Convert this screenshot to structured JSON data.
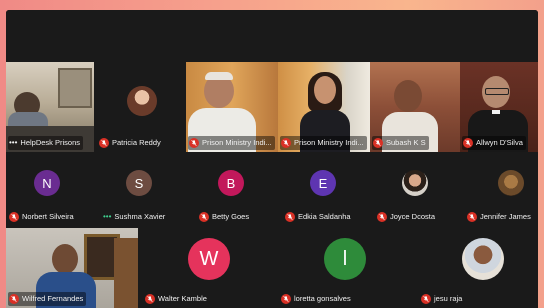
{
  "participants": {
    "helpdesk": {
      "name": "HelpDesk Prisons"
    },
    "patricia": {
      "name": "Patricia Reddy"
    },
    "prison1": {
      "name": "Prison Ministry Indi..."
    },
    "prison2": {
      "name": "Prison Ministry Indi..."
    },
    "subash": {
      "name": "Subash K S"
    },
    "allwyn": {
      "name": "Allwyn D'Silva"
    },
    "norbert": {
      "name": "Norbert Silveira",
      "initial": "N",
      "color": "#6a2c91"
    },
    "sushma": {
      "name": "Sushma Xavier",
      "initial": "S",
      "color": "#6d4c41"
    },
    "betty": {
      "name": "Betty Goes",
      "initial": "B",
      "color": "#c2185b"
    },
    "edkia": {
      "name": "Edkia Saldanha",
      "initial": "E",
      "color": "#5e35b1"
    },
    "joyce": {
      "name": "Joyce Dcosta"
    },
    "jennifer": {
      "name": "Jennifer James"
    },
    "wilfred": {
      "name": "Wilfred Fernandes"
    },
    "walter": {
      "name": "Walter Kamble",
      "initial": "W",
      "color": "#e5335c"
    },
    "loretta": {
      "name": "loretta gonsalves",
      "initial": "l",
      "color": "#2e8b3a"
    },
    "jesu": {
      "name": "jesu raja"
    }
  }
}
